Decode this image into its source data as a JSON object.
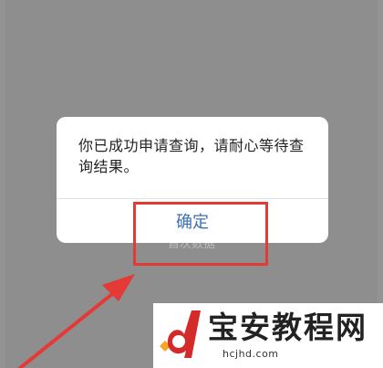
{
  "dialog": {
    "message": "你已成功申请查询，请耐心等待查询结果。",
    "confirm_label": "确定"
  },
  "background": {
    "obscured_text": "首次数据"
  },
  "annotation": {
    "highlight_color": "#e53935",
    "arrow_color": "#e53935"
  },
  "watermark": {
    "title": "宝安教程网",
    "url": "hcjhd.com"
  },
  "colors": {
    "overlay": "#8e8e8e",
    "dialog_bg": "#ffffff",
    "button_text": "#3a6fb4"
  }
}
